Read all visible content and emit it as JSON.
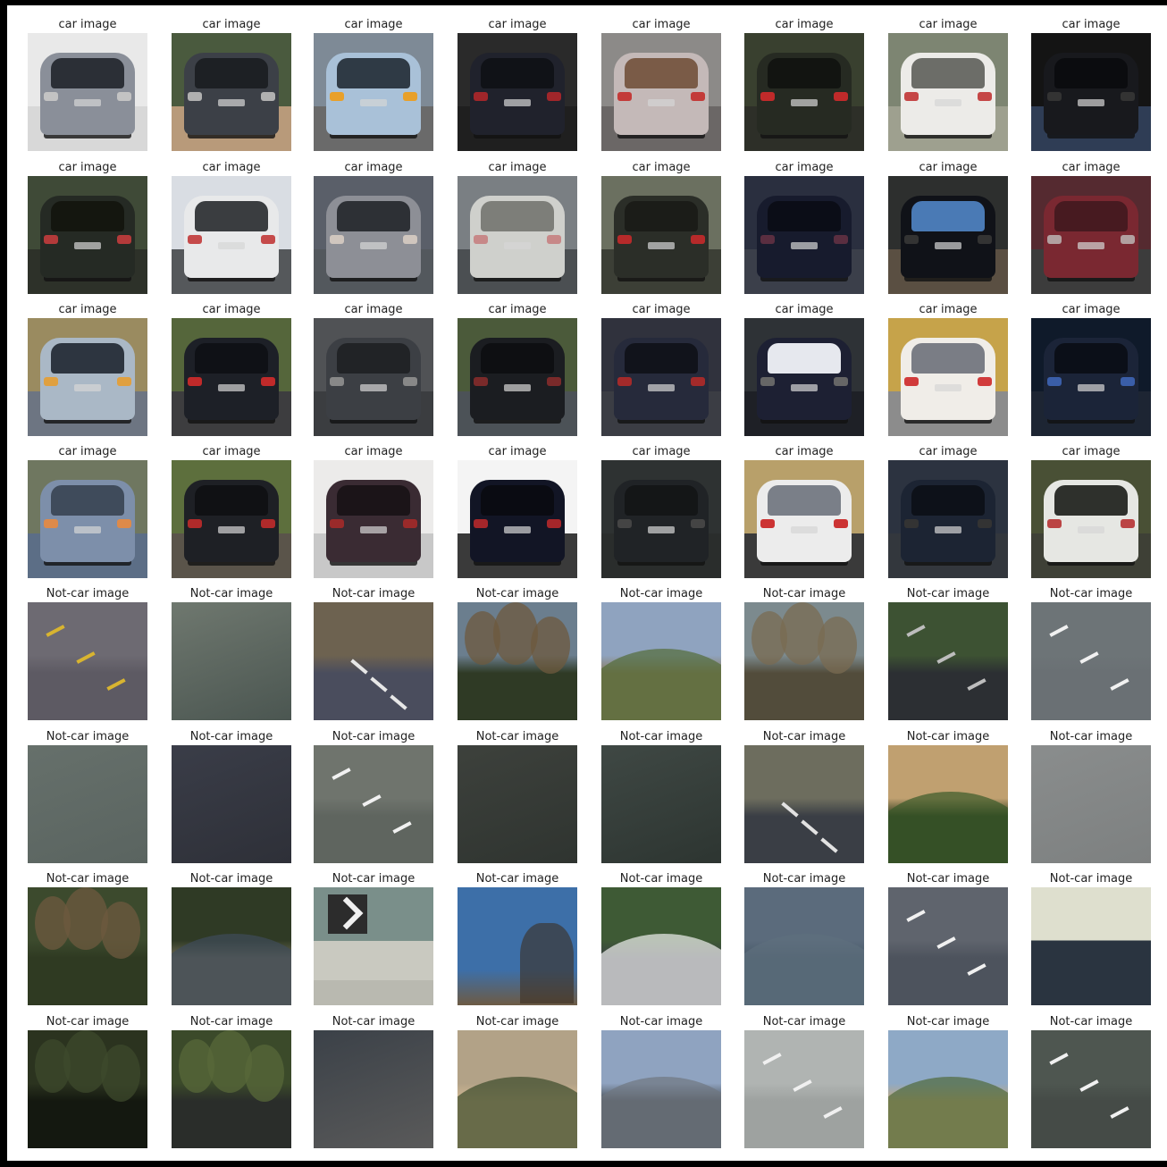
{
  "figure": {
    "rows": 8,
    "cols": 8,
    "captions": {
      "car": "car image",
      "notcar": "Not-car image"
    }
  },
  "tiles": [
    {
      "kind": "car",
      "bg": "#e9e9e9",
      "ground": "#d8d8d8",
      "car": "#8a8f99",
      "win": "#2b2f36",
      "light": "#c3c3c3"
    },
    {
      "kind": "car",
      "bg": "#4a5a3e",
      "ground": "#b89a7a",
      "car": "#3c4047",
      "win": "#1d2024",
      "light": "#b0b0b0"
    },
    {
      "kind": "car",
      "bg": "#7e8a96",
      "ground": "#6a6a6a",
      "car": "#a9c1d8",
      "win": "#2f3a45",
      "light": "#e8a02a"
    },
    {
      "kind": "car",
      "bg": "#2a2a2a",
      "ground": "#1f1f1f",
      "car": "#20222c",
      "win": "#101217",
      "light": "#a0262a"
    },
    {
      "kind": "car",
      "bg": "#8c8a88",
      "ground": "#6b6766",
      "car": "#c4b9b8",
      "win": "#7a5b47",
      "light": "#c33b39"
    },
    {
      "kind": "car",
      "bg": "#39402f",
      "ground": "#2d2f28",
      "car": "#262a22",
      "win": "#121411",
      "light": "#c02a2a"
    },
    {
      "kind": "car",
      "bg": "#7d8572",
      "ground": "#9ea08f",
      "car": "#ecebe8",
      "win": "#6c6d68",
      "light": "#c54646"
    },
    {
      "kind": "car",
      "bg": "#141414",
      "ground": "#2f3d55",
      "car": "#18191d",
      "win": "#0b0c0f",
      "light": "#333"
    },
    {
      "kind": "car",
      "bg": "#3f4a37",
      "ground": "#2d3129",
      "car": "#252a24",
      "win": "#14160f",
      "light": "#b33a3a"
    },
    {
      "kind": "car",
      "bg": "#d9dde3",
      "ground": "#55585b",
      "car": "#e8e9ea",
      "win": "#3a3d40",
      "light": "#c54a4a"
    },
    {
      "kind": "car",
      "bg": "#5a5f69",
      "ground": "#53585d",
      "car": "#8d8f96",
      "win": "#2d3035",
      "light": "#d0c6be"
    },
    {
      "kind": "car",
      "bg": "#7a7f83",
      "ground": "#4b4f52",
      "car": "#cfd0cc",
      "win": "#7d7e79",
      "light": "#c78888"
    },
    {
      "kind": "car",
      "bg": "#6b7060",
      "ground": "#3c3f36",
      "car": "#2b2e28",
      "win": "#1b1c18",
      "light": "#b62a2a"
    },
    {
      "kind": "car",
      "bg": "#2a2f3f",
      "ground": "#3b3f4a",
      "car": "#171b2d",
      "win": "#0b0d17",
      "light": "#5a2e40"
    },
    {
      "kind": "car",
      "bg": "#2d2f2e",
      "ground": "#5a4f42",
      "car": "#101218",
      "win": "#4a7ab5",
      "light": "#333"
    },
    {
      "kind": "car",
      "bg": "#552a30",
      "ground": "#3c3c3c",
      "car": "#7a2831",
      "win": "#471a20",
      "light": "#b2a0a0"
    },
    {
      "kind": "car",
      "bg": "#9a8b60",
      "ground": "#6d7582",
      "car": "#aab8c6",
      "win": "#2d3540",
      "light": "#e0a040"
    },
    {
      "kind": "car",
      "bg": "#55663b",
      "ground": "#3d3d3f",
      "car": "#1d2027",
      "win": "#0f1116",
      "light": "#c02a2a"
    },
    {
      "kind": "car",
      "bg": "#505255",
      "ground": "#3b3d40",
      "car": "#3c3f44",
      "win": "#212326",
      "light": "#888"
    },
    {
      "kind": "car",
      "bg": "#4b5a3a",
      "ground": "#4c5257",
      "car": "#1b1d21",
      "win": "#0e0f12",
      "light": "#7a2a2a"
    },
    {
      "kind": "car",
      "bg": "#30323d",
      "ground": "#3b3d44",
      "car": "#262a3b",
      "win": "#11131b",
      "light": "#a32a2a"
    },
    {
      "kind": "car",
      "bg": "#2e3236",
      "ground": "#1e2026",
      "car": "#1d2033",
      "win": "#e6e8ee",
      "light": "#666"
    },
    {
      "kind": "car",
      "bg": "#c6a34a",
      "ground": "#8c8c8c",
      "car": "#f0ede8",
      "win": "#7a7d85",
      "light": "#d13b3b"
    },
    {
      "kind": "car",
      "bg": "#0f1a2a",
      "ground": "#1d2533",
      "car": "#1b2438",
      "win": "#0b0f18",
      "light": "#3a5ea8"
    },
    {
      "kind": "car",
      "bg": "#6f7760",
      "ground": "#5c6e86",
      "car": "#7d8faa",
      "win": "#3f4b5b",
      "light": "#dd8a4a"
    },
    {
      "kind": "car",
      "bg": "#5d6f3d",
      "ground": "#5a544a",
      "car": "#1e2025",
      "win": "#101114",
      "light": "#b02a2a"
    },
    {
      "kind": "car",
      "bg": "#ecebea",
      "ground": "#c8c8c8",
      "car": "#3a2b33",
      "win": "#1b1418",
      "light": "#9a2a2a"
    },
    {
      "kind": "car",
      "bg": "#f4f4f4",
      "ground": "#3a3a3a",
      "car": "#121525",
      "win": "#0a0b12",
      "light": "#a5262a"
    },
    {
      "kind": "car",
      "bg": "#2e3232",
      "ground": "#2a2d2c",
      "car": "#202326",
      "win": "#141617",
      "light": "#444"
    },
    {
      "kind": "car",
      "bg": "#b8a06a",
      "ground": "#3a3a3a",
      "car": "#ececec",
      "win": "#7a7f88",
      "light": "#c33"
    },
    {
      "kind": "car",
      "bg": "#2c3340",
      "ground": "#33373d",
      "car": "#1c2433",
      "win": "#0d1119",
      "light": "#333"
    },
    {
      "kind": "car",
      "bg": "#495035",
      "ground": "#3e4036",
      "car": "#e6e7e3",
      "win": "#2e302c",
      "light": "#b44"
    },
    {
      "kind": "road",
      "top": "#6d6a72",
      "bottom": "#5d5a63",
      "mark": "#d8b430"
    },
    {
      "kind": "flat",
      "top": "#6f786f",
      "bottom": "#4b5651",
      "mark": "none"
    },
    {
      "kind": "curve",
      "top": "#6d6250",
      "bottom": "#4a4d5d",
      "mark": "#e7e7e7"
    },
    {
      "kind": "trees",
      "top": "#6b7e8e",
      "bottom": "#2f3a25",
      "mark": "#6e5a3e"
    },
    {
      "kind": "hill",
      "top": "#8fa3bf",
      "bottom": "#8c7c5d",
      "mark": "#526b37"
    },
    {
      "kind": "trees",
      "top": "#7c8a8e",
      "bottom": "#524c3b",
      "mark": "#7a6b52"
    },
    {
      "kind": "road",
      "top": "#3d5233",
      "bottom": "#2c2f33",
      "mark": "#bdbdbd"
    },
    {
      "kind": "road",
      "top": "#6d7477",
      "bottom": "#6a7074",
      "mark": "#f1f1f1"
    },
    {
      "kind": "flat",
      "top": "#66706b",
      "bottom": "#5a6460",
      "mark": "#d8d8d8"
    },
    {
      "kind": "flat",
      "top": "#3a3d48",
      "bottom": "#2e3038",
      "mark": "none"
    },
    {
      "kind": "road",
      "top": "#6f746d",
      "bottom": "#5f655f",
      "mark": "#f1f1f1"
    },
    {
      "kind": "flat",
      "top": "#3d413c",
      "bottom": "#2f3430",
      "mark": "none"
    },
    {
      "kind": "flat",
      "top": "#3f4844",
      "bottom": "#2d3531",
      "mark": "#8aa"
    },
    {
      "kind": "curve",
      "top": "#6d6d5e",
      "bottom": "#3a3e45",
      "mark": "#e2e2e2"
    },
    {
      "kind": "hill",
      "top": "#c0a070",
      "bottom": "#2a3b1e",
      "mark": "#3b5a2a"
    },
    {
      "kind": "flat",
      "top": "#8a8d8d",
      "bottom": "#7d8080",
      "mark": "none"
    },
    {
      "kind": "trees",
      "top": "#3c4a2d",
      "bottom": "#2f3a22",
      "mark": "#6d5a3f"
    },
    {
      "kind": "hill",
      "top": "#2f3a25",
      "bottom": "#6f6a55",
      "mark": "#3e4b5a"
    },
    {
      "kind": "sign",
      "top": "#7a8f8a",
      "bottom": "#b9b9b0",
      "mark": "#f0f0f0"
    },
    {
      "kind": "sky",
      "top": "#3d6fa8",
      "bottom": "#6d5b44",
      "mark": "#3c2f22"
    },
    {
      "kind": "hill",
      "top": "#3e5a35",
      "bottom": "#3a3f44",
      "mark": "#f0f0f0"
    },
    {
      "kind": "hill",
      "top": "#5b6b7c",
      "bottom": "#495a68",
      "mark": "#5e6f7d"
    },
    {
      "kind": "road",
      "top": "#5f646d",
      "bottom": "#4d535d",
      "mark": "#f1f1f1"
    },
    {
      "kind": "split",
      "top": "#dedfce",
      "bottom": "#2a3440",
      "mark": "#4b5a66"
    },
    {
      "kind": "trees",
      "top": "#2b331f",
      "bottom": "#141810",
      "mark": "#3e4a2c"
    },
    {
      "kind": "trees",
      "top": "#3b4a2a",
      "bottom": "#2a2d2a",
      "mark": "#58683a"
    },
    {
      "kind": "flat",
      "top": "#3b4148",
      "bottom": "#5a5a5a",
      "mark": "#d0d0d0"
    },
    {
      "kind": "hill",
      "top": "#b2a287",
      "bottom": "#d2b893",
      "mark": "#3a4a2a"
    },
    {
      "kind": "hill",
      "top": "#8fa3c0",
      "bottom": "#4a5055",
      "mark": "#6f7680"
    },
    {
      "kind": "road",
      "top": "#b0b4b2",
      "bottom": "#9ea2a0",
      "mark": "#f0f0f0"
    },
    {
      "kind": "hill",
      "top": "#8ea9c6",
      "bottom": "#c5a97b",
      "mark": "#506a3a"
    },
    {
      "kind": "road",
      "top": "#4e5650",
      "bottom": "#454b47",
      "mark": "#f1f1f1"
    }
  ]
}
